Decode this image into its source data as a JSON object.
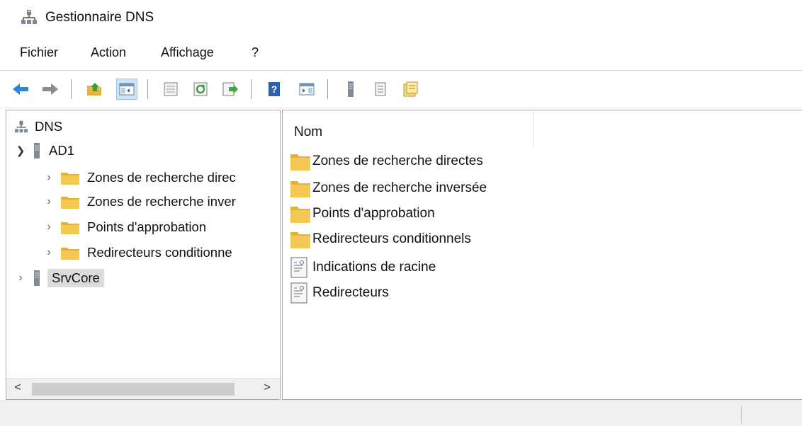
{
  "window": {
    "title": "Gestionnaire DNS",
    "icon": "dns-server-icon"
  },
  "menu": [
    "Fichier",
    "Action",
    "Affichage",
    "?"
  ],
  "toolbar": {
    "buttons": [
      "back-arrow-icon",
      "forward-arrow-icon",
      "up-folder-icon",
      "show-hide-console-tree-icon",
      "properties-icon",
      "refresh-icon",
      "export-list-icon",
      "help-icon",
      "show-hide-action-pane-icon",
      "server-icon",
      "list-icon",
      "notes-icon"
    ],
    "pressed": "show-hide-console-tree-icon"
  },
  "tree": {
    "root": "DNS",
    "servers": [
      {
        "name": "AD1",
        "expanded": true,
        "children": [
          "Zones de recherche direc",
          "Zones de recherche inver",
          "Points d'approbation",
          "Redirecteurs conditionne"
        ]
      },
      {
        "name": "SrvCore",
        "expanded": false,
        "selected": true
      }
    ]
  },
  "list": {
    "column_header": "Nom",
    "items": [
      {
        "label": "Zones de recherche directes",
        "icon": "folder-icon"
      },
      {
        "label": "Zones de recherche inversée",
        "icon": "folder-icon"
      },
      {
        "label": "Points d'approbation",
        "icon": "folder-icon"
      },
      {
        "label": "Redirecteurs conditionnels",
        "icon": "folder-icon"
      },
      {
        "label": "Indications de racine",
        "icon": "document-icon"
      },
      {
        "label": "Redirecteurs",
        "icon": "document-icon"
      }
    ]
  },
  "scrollbar": {
    "left_arrow": "<",
    "right_arrow": ">"
  },
  "colors": {
    "selected_bg": "#dcdcdc",
    "pressed_button_bg": "#cfe3f5",
    "folder_yellow": "#f3c853",
    "back_arrow_blue": "#2a86d6"
  }
}
